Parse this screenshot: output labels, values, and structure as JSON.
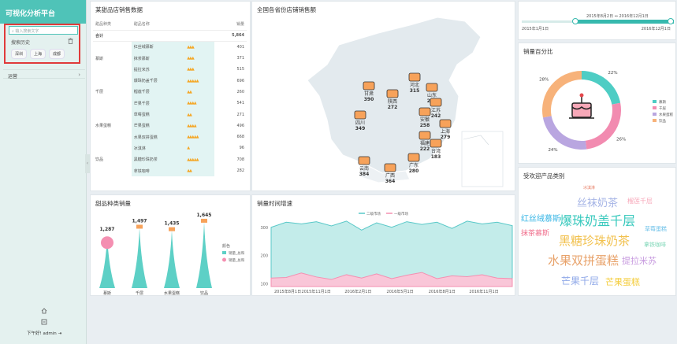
{
  "app": {
    "title": "可视化分析平台",
    "user": "下午好! admin"
  },
  "sidebar": {
    "search_placeholder": "输入搜索文字",
    "history_label": "搜索历史",
    "chips": [
      "深圳",
      "上海",
      "成都"
    ],
    "menu_label": "运营",
    "collapse": "‹"
  },
  "table": {
    "title": "某甜品店销售数据",
    "headers": [
      "甜品种类",
      "甜品名称",
      "",
      "销量"
    ],
    "total_label": "合计",
    "total_value": "5,864",
    "rows": [
      {
        "cat": "",
        "name": "红丝绒慕斯",
        "stars": 3,
        "value": "401"
      },
      {
        "cat": "慕斯",
        "name": "抹茶慕斯",
        "stars": 3,
        "value": "371"
      },
      {
        "cat": "",
        "name": "提拉米苏",
        "stars": 3,
        "value": "515"
      },
      {
        "cat": "",
        "name": "爆珠奶盖千层",
        "stars": 5,
        "value": "696"
      },
      {
        "cat": "千层",
        "name": "榴莲千层",
        "stars": 2,
        "value": "260"
      },
      {
        "cat": "",
        "name": "芒果千层",
        "stars": 4,
        "value": "541"
      },
      {
        "cat": "",
        "name": "草莓蛋糕",
        "stars": 2,
        "value": "271"
      },
      {
        "cat": "水果蛋糕",
        "name": "芒果蛋糕",
        "stars": 4,
        "value": "496"
      },
      {
        "cat": "",
        "name": "水果双拼蛋糕",
        "stars": 5,
        "value": "668"
      },
      {
        "cat": "",
        "name": "冰淇淋",
        "stars": 1,
        "value": "96"
      },
      {
        "cat": "饮品",
        "name": "黑糖珍珠奶茶",
        "stars": 5,
        "value": "708"
      },
      {
        "cat": "",
        "name": "拿铁咖啡",
        "stars": 2,
        "value": "282"
      }
    ]
  },
  "map": {
    "title": "全国各省份店铺销售额",
    "labels": [
      {
        "name": "甘肃",
        "value": "390"
      },
      {
        "name": "陕西",
        "value": "272"
      },
      {
        "name": "河北",
        "value": "315"
      },
      {
        "name": "山东",
        "value": "254"
      },
      {
        "name": "江苏",
        "value": "242"
      },
      {
        "name": "安徽",
        "value": "258"
      },
      {
        "name": "四川",
        "value": "349"
      },
      {
        "name": "上海",
        "value": "279"
      },
      {
        "name": "福建",
        "value": "222"
      },
      {
        "name": "台湾",
        "value": "183"
      },
      {
        "name": "云南",
        "value": "384"
      },
      {
        "name": "广西",
        "value": "364"
      },
      {
        "name": "广东",
        "value": "280"
      }
    ]
  },
  "range": {
    "start": "2015年1月1日",
    "end": "2016年12月1日",
    "sel_start": "2015年8月2日",
    "sel_end": "2016年12月1日",
    "sep": "↔",
    "start_frac": 0.35,
    "end_frac": 1.0
  },
  "donut": {
    "title": "销量百分比",
    "legend": [
      "慕斯",
      "千层",
      "水果蛋糕",
      "饮品"
    ],
    "colors": [
      "#4ecdc4",
      "#f28bb0",
      "#b9a6e0",
      "#f7b27a"
    ],
    "values": [
      22,
      26,
      24,
      28
    ]
  },
  "bar_chart": {
    "title": "甜品种类销量",
    "legend_title": "颜色",
    "legend": [
      "销量_总和",
      "销量_总和"
    ],
    "legend_colors": [
      "#5dd0c6",
      "#f48fb1"
    ],
    "chart_data": {
      "type": "bar",
      "categories": [
        "慕斯",
        "千层",
        "水果蛋糕",
        "饮品"
      ],
      "values": [
        1287,
        1497,
        1435,
        1645
      ],
      "labels": [
        "1,287",
        "1,497",
        "1,435",
        "1,645"
      ],
      "ylim": [
        0,
        1800
      ]
    }
  },
  "line_chart": {
    "title": "销量时间增速",
    "legend": [
      "二级市场",
      "一级市场"
    ],
    "colors": [
      "#58c8c8",
      "#f48fb1"
    ],
    "chart_data": {
      "type": "area",
      "x": [
        "2015年8月1日",
        "2015年11月1日",
        "2016年2月1日",
        "2016年5月1日",
        "2016年8月1日",
        "2016年11月1日"
      ],
      "yticks": [
        "100",
        "200",
        "300"
      ],
      "ylim": [
        90,
        330
      ],
      "series": [
        {
          "name": "二级市场",
          "values": [
            300,
            318,
            312,
            320,
            305,
            322,
            290,
            316,
            300,
            320,
            310,
            318,
            296,
            322,
            312,
            318,
            306
          ]
        },
        {
          "name": "一级市场",
          "values": [
            120,
            122,
            138,
            124,
            115,
            132,
            120,
            135,
            118,
            130,
            140,
            118,
            128,
            125,
            132,
            120,
            118
          ]
        }
      ]
    }
  },
  "wordcloud": {
    "title": "受欢迎产品类别",
    "words": [
      {
        "text": "冰淇淋",
        "color": "#e77f67"
      },
      {
        "text": "丝袜奶茶",
        "color": "#a5b4e6"
      },
      {
        "text": "榴莲千层",
        "color": "#f7a6b8"
      },
      {
        "text": "红丝绒慕斯",
        "color": "#3bb7e6"
      },
      {
        "text": "爆珠奶盖千层",
        "color": "#38c9bd"
      },
      {
        "text": "草莓蛋糕",
        "color": "#6bc0e8"
      },
      {
        "text": "抹茶慕斯",
        "color": "#f06e8c"
      },
      {
        "text": "黑糖珍珠奶茶",
        "color": "#f2c14e"
      },
      {
        "text": "拿铁咖啡",
        "color": "#7fd7b8"
      },
      {
        "text": "水果双拼蛋糕",
        "color": "#e8a26a"
      },
      {
        "text": "提拉米苏",
        "color": "#c79adf"
      },
      {
        "text": "芒果千层",
        "color": "#8fa8e8"
      },
      {
        "text": "芒果蛋糕",
        "color": "#f4cc3a"
      }
    ]
  }
}
